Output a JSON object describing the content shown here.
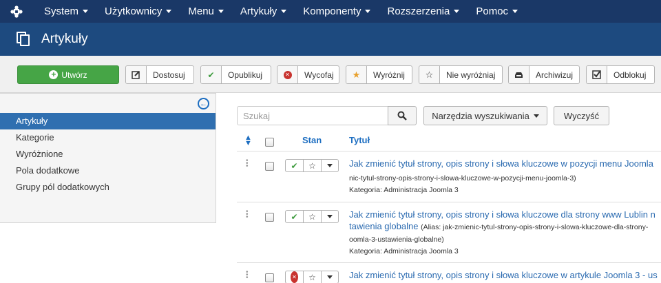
{
  "topnav": {
    "logo_icon": "joomla-logo-icon",
    "items": [
      {
        "label": "System"
      },
      {
        "label": "Użytkownicy"
      },
      {
        "label": "Menu"
      },
      {
        "label": "Artykuły"
      },
      {
        "label": "Komponenty"
      },
      {
        "label": "Rozszerzenia"
      },
      {
        "label": "Pomoc"
      }
    ]
  },
  "header": {
    "title": "Artykuły",
    "icon": "copy-icon"
  },
  "toolbar": {
    "new_label": "Utwórz",
    "buttons": [
      {
        "label": "Dostosuj",
        "icon": "edit-icon"
      },
      {
        "label": "Opublikuj",
        "icon": "check-icon"
      },
      {
        "label": "Wycofaj",
        "icon": "unpublish-icon"
      },
      {
        "label": "Wyróżnij",
        "icon": "star-filled-icon"
      },
      {
        "label": "Nie wyróżniaj",
        "icon": "star-empty-icon"
      },
      {
        "label": "Archiwizuj",
        "icon": "archive-icon"
      },
      {
        "label": "Odblokuj",
        "icon": "checkbox-icon"
      }
    ]
  },
  "sidebar": {
    "items": [
      {
        "label": "Artykuły",
        "active": true
      },
      {
        "label": "Kategorie"
      },
      {
        "label": "Wyróżnione"
      },
      {
        "label": "Pola dodatkowe"
      },
      {
        "label": "Grupy pól dodatkowych"
      }
    ]
  },
  "filters": {
    "search_placeholder": "Szukaj",
    "tools_label": "Narzędzia wyszukiwania",
    "clear_label": "Wyczyść"
  },
  "table": {
    "columns": {
      "status": "Stan",
      "title": "Tytuł"
    },
    "rows": [
      {
        "status": "published",
        "title": "Jak zmienić tytuł strony, opis strony i słowa kluczowe w pozycji menu Joomla",
        "alias_line": "nic-tytul-strony-opis-strony-i-slowa-kluczowe-w-pozycji-menu-joomla-3)",
        "category": "Kategoria: Administracja Joomla 3"
      },
      {
        "status": "published",
        "title": "Jak zmienić tytuł strony, opis strony i słowa kluczowe dla strony www Lublin n",
        "title_cont": "tawienia globalne",
        "alias_inline": "(Alias: jak-zmienic-tytul-strony-opis-strony-i-slowa-kluczowe-dla-strony-",
        "alias_line": "oomla-3-ustawienia-globalne)",
        "category": "Kategoria: Administracja Joomla 3"
      },
      {
        "status": "unpublished",
        "title": "Jak zmienić tytuł strony, opis strony i słowa kluczowe w artykule Joomla 3 - us"
      }
    ]
  },
  "colors": {
    "topnav_bg": "#1a3867",
    "header_bg": "#1d4a7f",
    "new_button": "#46a546",
    "sidebar_active": "#2f6fb0",
    "link": "#2a6ab0"
  }
}
